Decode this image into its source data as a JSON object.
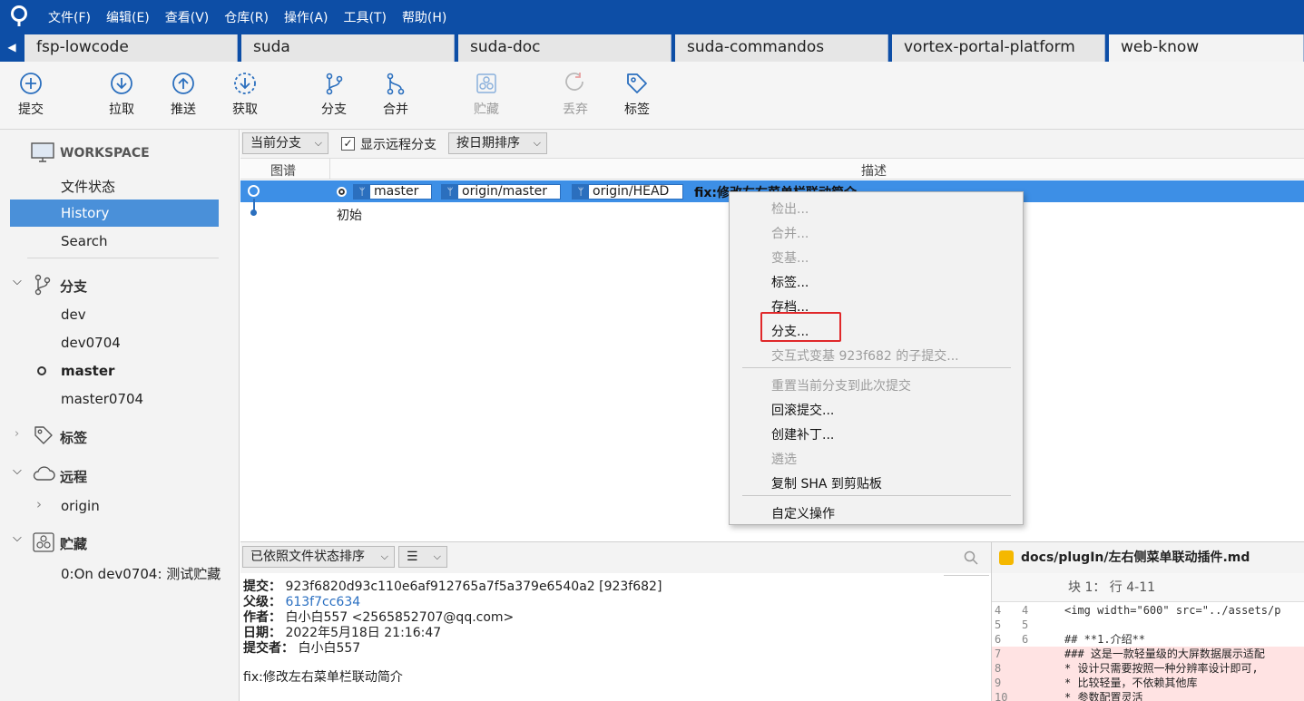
{
  "menubar": {
    "items": [
      "文件(F)",
      "编辑(E)",
      "查看(V)",
      "仓库(R)",
      "操作(A)",
      "工具(T)",
      "帮助(H)"
    ]
  },
  "tabs": [
    "fsp-lowcode",
    "suda",
    "suda-doc",
    "suda-commandos",
    "vortex-portal-platform",
    "web-know"
  ],
  "toolbar": {
    "commit": "提交",
    "pull": "拉取",
    "push": "推送",
    "fetch": "获取",
    "branch": "分支",
    "merge": "合并",
    "stash": "贮藏",
    "discard": "丢弃",
    "tag": "标签"
  },
  "sidebar": {
    "workspace": "WORKSPACE",
    "file_status": "文件状态",
    "history": "History",
    "search": "Search",
    "branches_header": "分支",
    "branches": [
      "dev",
      "dev0704",
      "master",
      "master0704"
    ],
    "tags_header": "标签",
    "remotes_header": "远程",
    "remotes": [
      "origin"
    ],
    "stashes_header": "贮藏",
    "stashes": [
      "0:On dev0704: 测试贮藏"
    ]
  },
  "filters": {
    "branch_select": "当前分支",
    "show_remote": "显示远程分支",
    "sort_select": "按日期排序"
  },
  "columns": {
    "graph": "图谱",
    "description": "描述"
  },
  "log": {
    "refs": [
      "master",
      "origin/master",
      "origin/HEAD"
    ],
    "row1_message": "fix:修改左右菜单栏联动简介",
    "row2_message": "初始"
  },
  "context_menu": {
    "checkout": "检出...",
    "merge": "合并...",
    "rebase": "变基...",
    "tag": "标签...",
    "archive": "存档...",
    "branch": "分支...",
    "interactive_rebase": "交互式变基 923f682 的子提交...",
    "reset": "重置当前分支到此次提交",
    "revert": "回滚提交...",
    "patch": "创建补丁...",
    "cherry_pick": "遴选",
    "copy_sha": "复制 SHA 到剪贴板",
    "custom": "自定义操作"
  },
  "details": {
    "sort_select": "已依照文件状态排序",
    "commit_label": "提交：",
    "commit_value": "923f6820d93c110e6af912765a7f5a379e6540a2 [923f682]",
    "parent_label": "父级：",
    "parent_value": "613f7cc634",
    "author_label": "作者：",
    "author_value": "白小白557 <2565852707@qq.com>",
    "date_label": "日期：",
    "date_value": "2022年5月18日 21:16:47",
    "committer_label": "提交者：",
    "committer_value": "白小白557",
    "message": "fix:修改左右菜单栏联动简介"
  },
  "diff": {
    "file": "docs/plugIn/左右侧菜单联动插件.md",
    "hunk": "块 1： 行 4-11",
    "lines": [
      {
        "a": "4",
        "b": "4",
        "code": "<img width=\"600\" src=\"../assets/p"
      },
      {
        "a": "5",
        "b": "5",
        "code": ""
      },
      {
        "a": "6",
        "b": "6",
        "code": "## **1.介绍**"
      },
      {
        "a": "7",
        "b": "",
        "code": "### 这是一款轻量级的大屏数据展示适配"
      },
      {
        "a": "8",
        "b": "",
        "code": "*  设计只需要按照一种分辨率设计即可,"
      },
      {
        "a": "9",
        "b": "",
        "code": "*  比较轻量，不依赖其他库"
      },
      {
        "a": "10",
        "b": "",
        "code": "*  参数配置灵活"
      }
    ]
  },
  "colors": {
    "brand": "#0d4ea6",
    "selection": "#3d8fe6",
    "highlight_box": "#e0282a"
  }
}
